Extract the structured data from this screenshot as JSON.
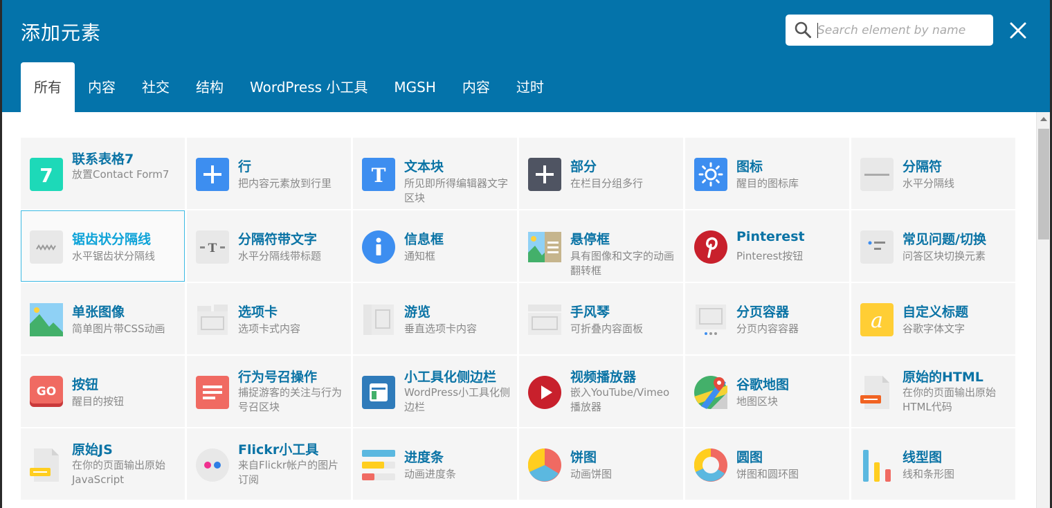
{
  "dialog": {
    "title": "添加元素",
    "search_placeholder": "Search element by name"
  },
  "tabs": [
    {
      "label": "所有",
      "active": true
    },
    {
      "label": "内容"
    },
    {
      "label": "社交"
    },
    {
      "label": "结构"
    },
    {
      "label": "WordPress 小工具"
    },
    {
      "label": "MGSH"
    },
    {
      "label": "内容"
    },
    {
      "label": "过时"
    }
  ],
  "colors": {
    "header": "#0473aa",
    "accent_text": "#0a73a5",
    "selected_border": "#3bb9e3"
  },
  "elements": [
    {
      "name": "联系表格7",
      "desc": "放置Contact Form7",
      "icon": "contact-form-7-icon"
    },
    {
      "name": "行",
      "desc": "把内容元素放到行里",
      "icon": "row-plus-icon"
    },
    {
      "name": "文本块",
      "desc": "所见即所得编辑器文字区块",
      "icon": "text-block-icon"
    },
    {
      "name": "部分",
      "desc": "在栏目分组多行",
      "icon": "section-plus-icon"
    },
    {
      "name": "图标",
      "desc": "醒目的图标库",
      "icon": "sun-icon"
    },
    {
      "name": "分隔符",
      "desc": "水平分隔线",
      "icon": "separator-icon"
    },
    {
      "name": "锯齿状分隔线",
      "desc": "水平锯齿状分隔线",
      "icon": "zigzag-icon",
      "selected": true
    },
    {
      "name": "分隔符带文字",
      "desc": "水平分隔线带标题",
      "icon": "separator-text-icon"
    },
    {
      "name": "信息框",
      "desc": "通知框",
      "icon": "info-icon"
    },
    {
      "name": "悬停框",
      "desc": "具有图像和文字的动画翻转框",
      "icon": "hover-box-icon"
    },
    {
      "name": "Pinterest",
      "desc": "Pinterest按钮",
      "icon": "pinterest-icon"
    },
    {
      "name": "常见问题/切换",
      "desc": "问答区块切换元素",
      "icon": "faq-toggle-icon"
    },
    {
      "name": "单张图像",
      "desc": "简单图片带CSS动画",
      "icon": "image-icon"
    },
    {
      "name": "选项卡",
      "desc": "选项卡式内容",
      "icon": "tabs-icon"
    },
    {
      "name": "游览",
      "desc": "垂直选项卡内容",
      "icon": "tour-icon"
    },
    {
      "name": "手风琴",
      "desc": "可折叠内容面板",
      "icon": "accordion-icon"
    },
    {
      "name": "分页容器",
      "desc": "分页内容容器",
      "icon": "pageable-container-icon"
    },
    {
      "name": "自定义标题",
      "desc": "谷歌字体文字",
      "icon": "custom-heading-icon"
    },
    {
      "name": "按钮",
      "desc": "醒目的按钮",
      "icon": "go-button-icon"
    },
    {
      "name": "行为号召操作",
      "desc": "捕捉游客的关注与行为号召区块",
      "icon": "call-to-action-icon"
    },
    {
      "name": "小工具化侧边栏",
      "desc": "WordPress小工具化侧边栏",
      "icon": "widget-sidebar-icon"
    },
    {
      "name": "视频播放器",
      "desc": "嵌入YouTube/Vimeo播放器",
      "icon": "video-player-icon"
    },
    {
      "name": "谷歌地图",
      "desc": "地图区块",
      "icon": "google-maps-icon"
    },
    {
      "name": "原始的HTML",
      "desc": "在你的页面输出原始HTML代码",
      "icon": "raw-html-icon"
    },
    {
      "name": "原始JS",
      "desc": "在你的页面输出原始JavaScript",
      "icon": "raw-js-icon"
    },
    {
      "name": "Flickr小工具",
      "desc": "来自Flickr帐户的图片订阅",
      "icon": "flickr-icon"
    },
    {
      "name": "进度条",
      "desc": "动画进度条",
      "icon": "progress-bar-icon"
    },
    {
      "name": "饼图",
      "desc": "动画饼图",
      "icon": "pie-chart-icon"
    },
    {
      "name": "圆图",
      "desc": "饼图和圆环图",
      "icon": "donut-chart-icon"
    },
    {
      "name": "线型图",
      "desc": "线和条形图",
      "icon": "bar-chart-icon"
    }
  ]
}
